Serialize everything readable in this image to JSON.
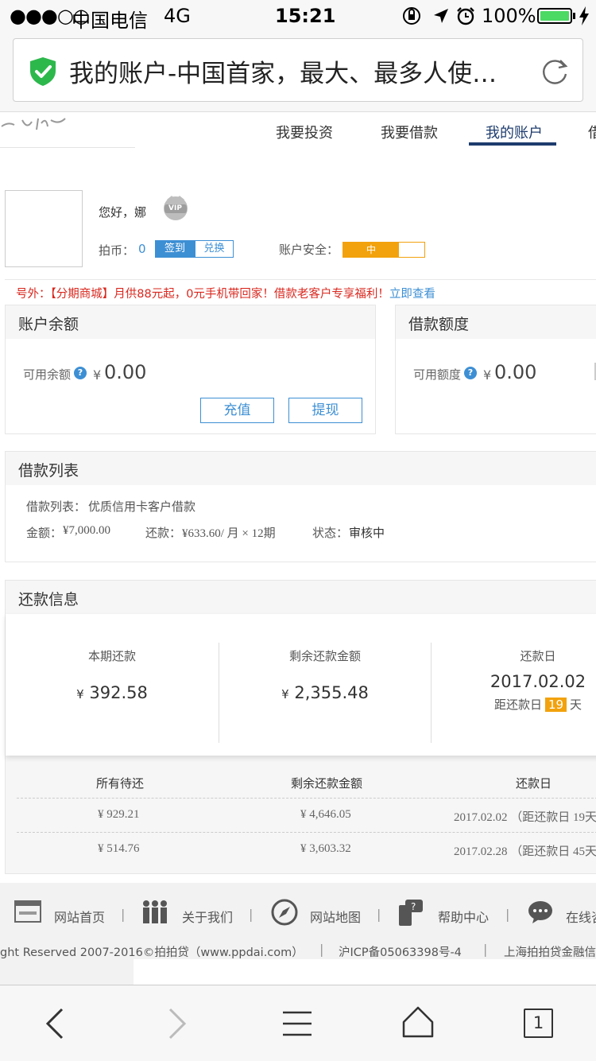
{
  "status_bar": {
    "signal": "●●●○○",
    "carrier": "中国电信",
    "network": "4G",
    "time": "15:21",
    "battery": "100%"
  },
  "browser": {
    "page_title": "我的账户-中国首家，最大、最多人使…",
    "tab_count": "1"
  },
  "site_nav": {
    "items": [
      "我要投资",
      "我要借款",
      "我的账户",
      "借"
    ],
    "active_index": 2
  },
  "profile": {
    "greeting": "您好，",
    "name": "娜",
    "vip_label": "VIP",
    "coin_label": "拍币：",
    "coin_value": "0",
    "sign_button": "签到",
    "exchange_button": "兑换",
    "security_label": "账户安全：",
    "security_level": "中"
  },
  "promo": {
    "prefix": "号外：",
    "text": "【分期商城】月供88元起，0元手机带回家！借款老客户专享福利！",
    "link": "立即查看"
  },
  "balance": {
    "title": "账户余额",
    "label": "可用余额",
    "currency": "¥",
    "amount": "0.00",
    "recharge_button": "充值",
    "withdraw_button": "提现"
  },
  "credit": {
    "title": "借款额度",
    "label": "可用额度",
    "currency": "¥",
    "amount": "0.00"
  },
  "loan_list": {
    "title": "借款列表",
    "list_label": "借款列表：",
    "list_value": "优质信用卡客户借款",
    "amount_label": "金额：",
    "amount_value": "¥7,000.00",
    "repay_label": "还款：",
    "repay_value": "¥633.60/ 月 × 12期",
    "status_label": "状态：",
    "status_value": "审核中"
  },
  "repayment": {
    "title": "还款信息",
    "current_label": "本期还款",
    "current_currency": "¥",
    "current_value": "392.58",
    "remaining_label": "剩余还款金额",
    "remaining_currency": "¥",
    "remaining_value": "2,355.48",
    "due_label": "还款日",
    "due_date": "2017.02.02",
    "due_prefix": "距还款日",
    "due_days": "19",
    "due_suffix": "天"
  },
  "repayment_table": {
    "headers": [
      "所有待还",
      "剩余还款金额",
      "还款日"
    ],
    "rows": [
      [
        "¥ 929.21",
        "¥ 4,646.05",
        "2017.02.02 （距还款日 19天"
      ],
      [
        "¥ 514.76",
        "¥ 3,603.32",
        "2017.02.28 （距还款日 45天"
      ]
    ]
  },
  "footer": {
    "links": [
      "网站首页",
      "关于我们",
      "网站地图",
      "帮助中心",
      "在线咨"
    ],
    "separator": "|",
    "copyright": "ght Reserved 2007-2016©拍拍贷（www.ppdai.com）",
    "icp": "沪ICP备05063398号-4",
    "company": "上海拍拍贷金融信"
  },
  "colors": {
    "link_blue": "#3d8fd4",
    "promo_red": "#d9271e",
    "security_orange": "#f2a20d",
    "nav_active": "#1e3c6e",
    "battery_green": "#4cd964",
    "shield_green": "#2db84c"
  }
}
